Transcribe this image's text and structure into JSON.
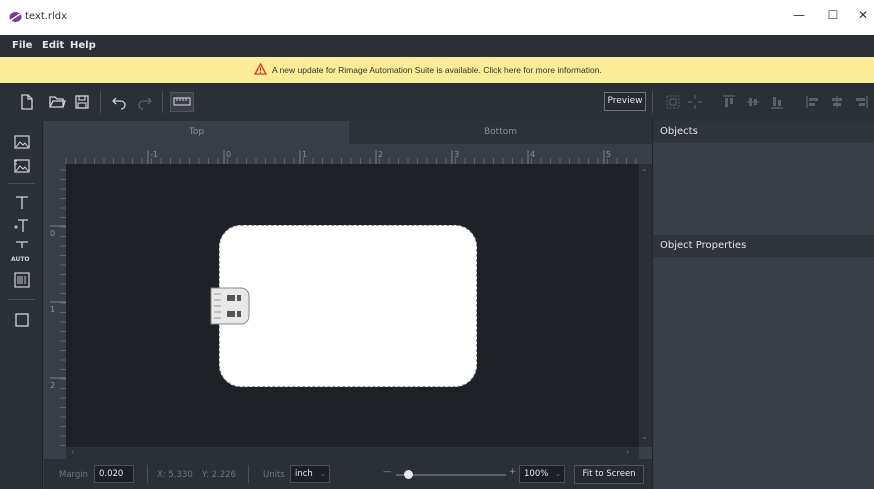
{
  "window": {
    "title": "text.rldx",
    "minimize": "—",
    "maximize": "☐",
    "close": "✕"
  },
  "menu": {
    "items": [
      "File",
      "Edit",
      "Help"
    ]
  },
  "banner": {
    "message": "A new update for Rimage Automation Suite is available. Click here for more information.",
    "icon": "warning-icon",
    "color": "#fcec98"
  },
  "toolbar": {
    "icons": [
      "new-file-icon",
      "open-folder-icon",
      "save-icon",
      "undo-icon",
      "redo-icon",
      "ruler-icon"
    ],
    "preview_label": "Preview",
    "align_icons": [
      "group-icon",
      "ungroup-icon",
      "align-top-icon",
      "align-middle-icon",
      "align-bottom-icon",
      "align-left-icon",
      "align-center-icon",
      "align-right-icon"
    ]
  },
  "tools": [
    "image-icon",
    "image-placeholder-icon",
    "text-icon",
    "text-field-icon",
    "auto-text-icon",
    "barcode-icon",
    "rectangle-icon"
  ],
  "tools_auto_label": "AUTO",
  "tabs": {
    "top": "Top",
    "bottom": "Bottom",
    "active": "Top"
  },
  "ruler": {
    "h_labels": [
      "-1",
      "0",
      "1",
      "2",
      "3",
      "4",
      "5"
    ],
    "v_labels": [
      "0",
      "1",
      "2"
    ]
  },
  "status": {
    "margin_label": "Margin",
    "margin_value": "0.020",
    "x_coord": "X: 5.330",
    "y_coord": "Y: 2.226",
    "units_label": "Units",
    "units_value": "inch",
    "zoom_minus": "—",
    "zoom_plus": "+",
    "zoom_value": "100%",
    "fit_label": "Fit to Screen"
  },
  "right_panel": {
    "objects_title": "Objects",
    "properties_title": "Object Properties"
  },
  "colors": {
    "accent": "#2b2f36",
    "canvas": "#1e2126",
    "banner": "#fcec98"
  }
}
